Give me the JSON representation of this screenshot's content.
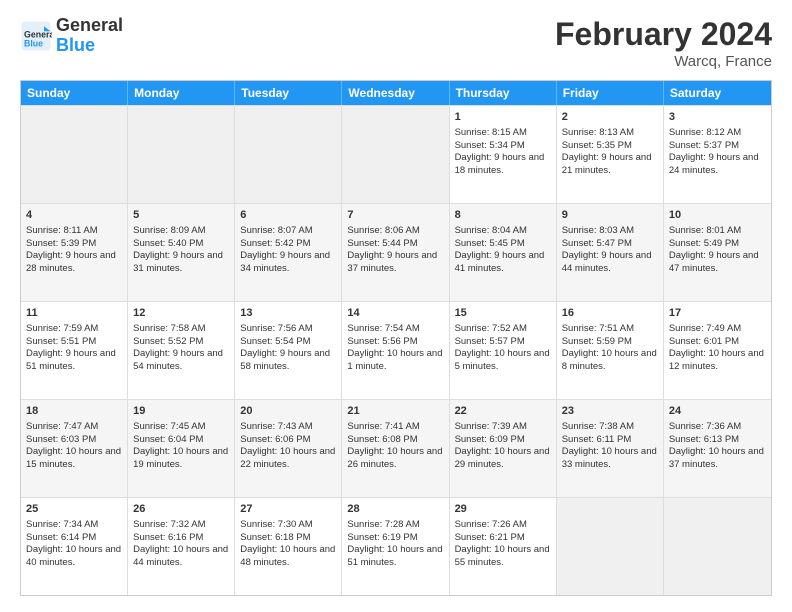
{
  "header": {
    "logo_line1": "General",
    "logo_line2": "Blue",
    "main_title": "February 2024",
    "subtitle": "Warcq, France"
  },
  "calendar": {
    "days_of_week": [
      "Sunday",
      "Monday",
      "Tuesday",
      "Wednesday",
      "Thursday",
      "Friday",
      "Saturday"
    ],
    "rows": [
      [
        {
          "day": "",
          "empty": true
        },
        {
          "day": "",
          "empty": true
        },
        {
          "day": "",
          "empty": true
        },
        {
          "day": "",
          "empty": true
        },
        {
          "day": "1",
          "sunrise": "Sunrise: 8:15 AM",
          "sunset": "Sunset: 5:34 PM",
          "daylight": "Daylight: 9 hours and 18 minutes."
        },
        {
          "day": "2",
          "sunrise": "Sunrise: 8:13 AM",
          "sunset": "Sunset: 5:35 PM",
          "daylight": "Daylight: 9 hours and 21 minutes."
        },
        {
          "day": "3",
          "sunrise": "Sunrise: 8:12 AM",
          "sunset": "Sunset: 5:37 PM",
          "daylight": "Daylight: 9 hours and 24 minutes."
        }
      ],
      [
        {
          "day": "4",
          "sunrise": "Sunrise: 8:11 AM",
          "sunset": "Sunset: 5:39 PM",
          "daylight": "Daylight: 9 hours and 28 minutes."
        },
        {
          "day": "5",
          "sunrise": "Sunrise: 8:09 AM",
          "sunset": "Sunset: 5:40 PM",
          "daylight": "Daylight: 9 hours and 31 minutes."
        },
        {
          "day": "6",
          "sunrise": "Sunrise: 8:07 AM",
          "sunset": "Sunset: 5:42 PM",
          "daylight": "Daylight: 9 hours and 34 minutes."
        },
        {
          "day": "7",
          "sunrise": "Sunrise: 8:06 AM",
          "sunset": "Sunset: 5:44 PM",
          "daylight": "Daylight: 9 hours and 37 minutes."
        },
        {
          "day": "8",
          "sunrise": "Sunrise: 8:04 AM",
          "sunset": "Sunset: 5:45 PM",
          "daylight": "Daylight: 9 hours and 41 minutes."
        },
        {
          "day": "9",
          "sunrise": "Sunrise: 8:03 AM",
          "sunset": "Sunset: 5:47 PM",
          "daylight": "Daylight: 9 hours and 44 minutes."
        },
        {
          "day": "10",
          "sunrise": "Sunrise: 8:01 AM",
          "sunset": "Sunset: 5:49 PM",
          "daylight": "Daylight: 9 hours and 47 minutes."
        }
      ],
      [
        {
          "day": "11",
          "sunrise": "Sunrise: 7:59 AM",
          "sunset": "Sunset: 5:51 PM",
          "daylight": "Daylight: 9 hours and 51 minutes."
        },
        {
          "day": "12",
          "sunrise": "Sunrise: 7:58 AM",
          "sunset": "Sunset: 5:52 PM",
          "daylight": "Daylight: 9 hours and 54 minutes."
        },
        {
          "day": "13",
          "sunrise": "Sunrise: 7:56 AM",
          "sunset": "Sunset: 5:54 PM",
          "daylight": "Daylight: 9 hours and 58 minutes."
        },
        {
          "day": "14",
          "sunrise": "Sunrise: 7:54 AM",
          "sunset": "Sunset: 5:56 PM",
          "daylight": "Daylight: 10 hours and 1 minute."
        },
        {
          "day": "15",
          "sunrise": "Sunrise: 7:52 AM",
          "sunset": "Sunset: 5:57 PM",
          "daylight": "Daylight: 10 hours and 5 minutes."
        },
        {
          "day": "16",
          "sunrise": "Sunrise: 7:51 AM",
          "sunset": "Sunset: 5:59 PM",
          "daylight": "Daylight: 10 hours and 8 minutes."
        },
        {
          "day": "17",
          "sunrise": "Sunrise: 7:49 AM",
          "sunset": "Sunset: 6:01 PM",
          "daylight": "Daylight: 10 hours and 12 minutes."
        }
      ],
      [
        {
          "day": "18",
          "sunrise": "Sunrise: 7:47 AM",
          "sunset": "Sunset: 6:03 PM",
          "daylight": "Daylight: 10 hours and 15 minutes."
        },
        {
          "day": "19",
          "sunrise": "Sunrise: 7:45 AM",
          "sunset": "Sunset: 6:04 PM",
          "daylight": "Daylight: 10 hours and 19 minutes."
        },
        {
          "day": "20",
          "sunrise": "Sunrise: 7:43 AM",
          "sunset": "Sunset: 6:06 PM",
          "daylight": "Daylight: 10 hours and 22 minutes."
        },
        {
          "day": "21",
          "sunrise": "Sunrise: 7:41 AM",
          "sunset": "Sunset: 6:08 PM",
          "daylight": "Daylight: 10 hours and 26 minutes."
        },
        {
          "day": "22",
          "sunrise": "Sunrise: 7:39 AM",
          "sunset": "Sunset: 6:09 PM",
          "daylight": "Daylight: 10 hours and 29 minutes."
        },
        {
          "day": "23",
          "sunrise": "Sunrise: 7:38 AM",
          "sunset": "Sunset: 6:11 PM",
          "daylight": "Daylight: 10 hours and 33 minutes."
        },
        {
          "day": "24",
          "sunrise": "Sunrise: 7:36 AM",
          "sunset": "Sunset: 6:13 PM",
          "daylight": "Daylight: 10 hours and 37 minutes."
        }
      ],
      [
        {
          "day": "25",
          "sunrise": "Sunrise: 7:34 AM",
          "sunset": "Sunset: 6:14 PM",
          "daylight": "Daylight: 10 hours and 40 minutes."
        },
        {
          "day": "26",
          "sunrise": "Sunrise: 7:32 AM",
          "sunset": "Sunset: 6:16 PM",
          "daylight": "Daylight: 10 hours and 44 minutes."
        },
        {
          "day": "27",
          "sunrise": "Sunrise: 7:30 AM",
          "sunset": "Sunset: 6:18 PM",
          "daylight": "Daylight: 10 hours and 48 minutes."
        },
        {
          "day": "28",
          "sunrise": "Sunrise: 7:28 AM",
          "sunset": "Sunset: 6:19 PM",
          "daylight": "Daylight: 10 hours and 51 minutes."
        },
        {
          "day": "29",
          "sunrise": "Sunrise: 7:26 AM",
          "sunset": "Sunset: 6:21 PM",
          "daylight": "Daylight: 10 hours and 55 minutes."
        },
        {
          "day": "",
          "empty": true
        },
        {
          "day": "",
          "empty": true
        }
      ]
    ]
  }
}
